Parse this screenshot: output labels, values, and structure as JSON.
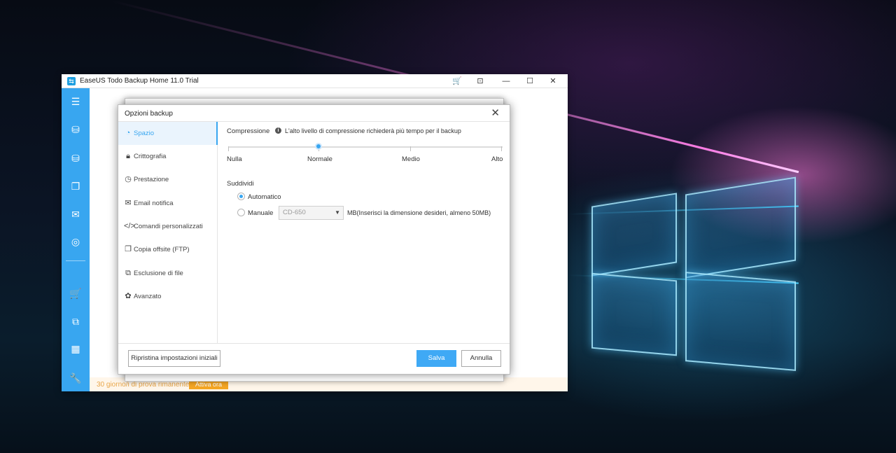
{
  "app": {
    "title": "EaseUS Todo Backup Home 11.0 Trial",
    "cart_icon": "cart-icon",
    "controls": {
      "restore": "⊡",
      "minimize": "—",
      "maximize": "☐",
      "close": "✕"
    }
  },
  "sidebar": {
    "icons": [
      "menu-icon",
      "disk-backup-icon",
      "system-backup-icon",
      "file-backup-icon",
      "mail-backup-icon",
      "smart-backup-icon",
      "cart-icon",
      "clone-icon",
      "tools-icon",
      "settings-icon"
    ]
  },
  "trial": {
    "text": "30 giorno/i di prova rimanente.",
    "button": "Attiva ora"
  },
  "dialog": {
    "title": "Opzioni backup",
    "close": "✕",
    "nav": [
      {
        "label": "Spazio",
        "active": true
      },
      {
        "label": "Crittografia",
        "active": false
      },
      {
        "label": "Prestazione",
        "active": false
      },
      {
        "label": "Email notifica",
        "active": false
      },
      {
        "label": "Comandi personalizzati",
        "active": false
      },
      {
        "label": "Copia offsite (FTP)",
        "active": false
      },
      {
        "label": "Esclusione di file",
        "active": false
      },
      {
        "label": "Avanzato",
        "active": false
      }
    ],
    "compression": {
      "label": "Compressione",
      "info": "L'alto livello di compressione richiederà più tempo per il backup",
      "levels": [
        "Nulla",
        "Normale",
        "Medio",
        "Alto"
      ],
      "selected": "Normale"
    },
    "split": {
      "label": "Suddividi",
      "auto_label": "Automatico",
      "manual_label": "Manuale",
      "selected": "Automatico",
      "size_value": "CD-650",
      "size_hint": "MB(Inserisci la dimensione desideri, almeno 50MB)"
    },
    "buttons": {
      "reset": "Ripristina impostazioni iniziali",
      "save": "Salva",
      "cancel": "Annulla"
    }
  },
  "colors": {
    "accent": "#38a6f0",
    "trial": "#f5a623"
  }
}
